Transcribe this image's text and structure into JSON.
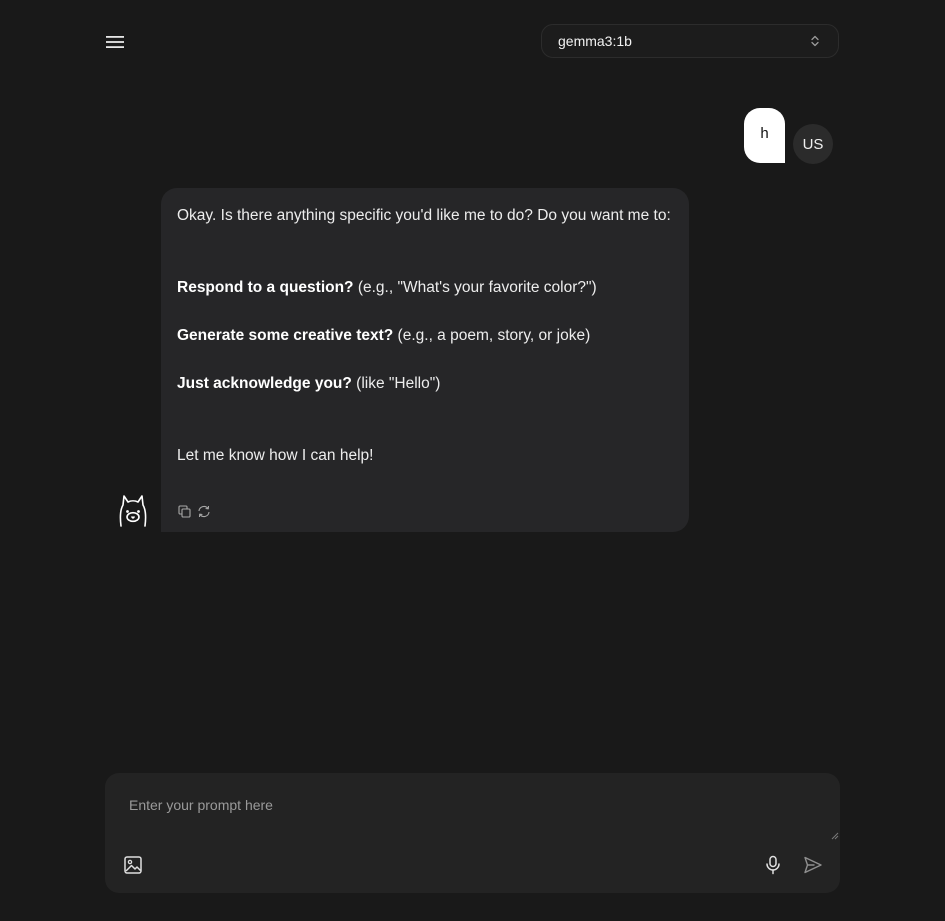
{
  "header": {
    "model": "gemma3:1b"
  },
  "conversation": {
    "user_message": "h",
    "user_avatar_text": "US",
    "assistant": {
      "intro": "Okay. Is there anything specific you'd like me to do?  Do you want me to:",
      "options": [
        {
          "bold": "Respond to a question?",
          "rest": " (e.g., \"What's your favorite color?\")"
        },
        {
          "bold": "Generate some creative text?",
          "rest": " (e.g., a poem, story, or joke)"
        },
        {
          "bold": "Just acknowledge you?",
          "rest": " (like \"Hello\")"
        }
      ],
      "closing": "Let me know how I can help!"
    }
  },
  "composer": {
    "placeholder": "Enter your prompt here"
  },
  "icons": {
    "menu": "hamburger-menu-icon",
    "model_select": "chevron-up-down-icon",
    "assistant_avatar": "llama-icon",
    "copy": "copy-icon",
    "regenerate": "refresh-icon",
    "attach_image": "image-icon",
    "microphone": "microphone-icon",
    "send": "send-icon"
  }
}
